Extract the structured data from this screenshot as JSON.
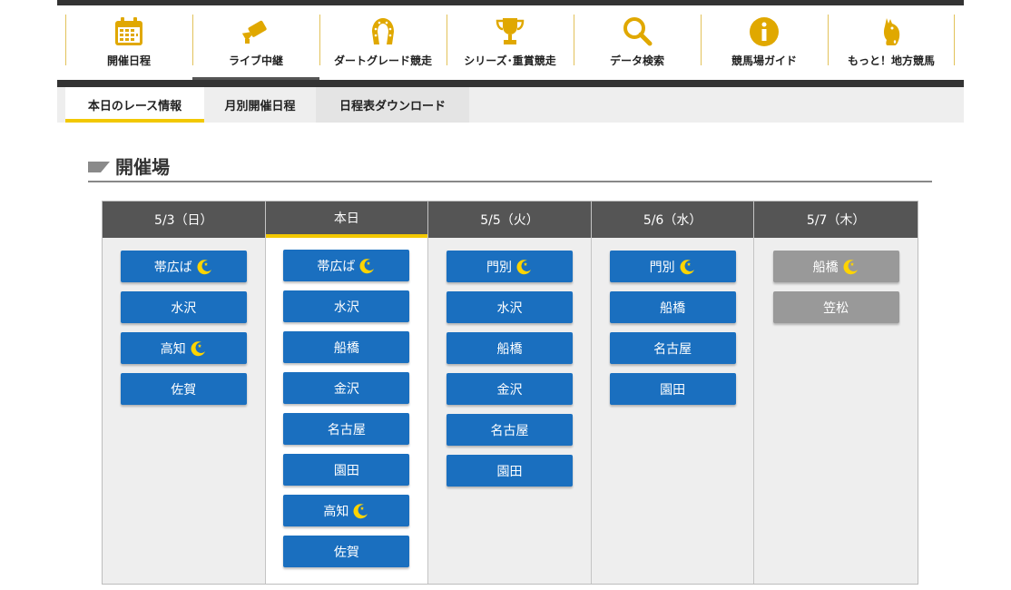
{
  "nav": {
    "items": [
      {
        "label": "開催日程",
        "icon": "calendar-icon"
      },
      {
        "label": "ライブ中継",
        "icon": "camera-icon"
      },
      {
        "label": "ダートグレード競走",
        "icon": "horseshoe-icon"
      },
      {
        "label": "シリーズ･重賞競走",
        "icon": "trophy-icon"
      },
      {
        "label": "データ検索",
        "icon": "search-icon"
      },
      {
        "label": "競馬場ガイド",
        "icon": "info-icon"
      },
      {
        "label": "もっと！地方競馬",
        "icon": "horse-head-icon"
      }
    ],
    "accent": "#e0a800"
  },
  "subtabs": [
    "本日のレース情報",
    "月別開催日程",
    "日程表ダウンロード"
  ],
  "section": {
    "title": "開催場"
  },
  "colors": {
    "venue_blue": "#1a6fbf",
    "venue_gray": "#999999",
    "header_dark": "#555555",
    "highlight_yellow": "#f2c800"
  },
  "days": [
    {
      "label": "5/3（日）",
      "venues": [
        {
          "name": "帯広ば",
          "night": true
        },
        {
          "name": "水沢",
          "night": false
        },
        {
          "name": "高知",
          "night": true
        },
        {
          "name": "佐賀",
          "night": false
        }
      ]
    },
    {
      "label": "本日",
      "venues": [
        {
          "name": "帯広ば",
          "night": true
        },
        {
          "name": "水沢",
          "night": false
        },
        {
          "name": "船橋",
          "night": false
        },
        {
          "name": "金沢",
          "night": false
        },
        {
          "name": "名古屋",
          "night": false
        },
        {
          "name": "園田",
          "night": false
        },
        {
          "name": "高知",
          "night": true
        },
        {
          "name": "佐賀",
          "night": false
        }
      ]
    },
    {
      "label": "5/5（火）",
      "venues": [
        {
          "name": "門別",
          "night": true
        },
        {
          "name": "水沢",
          "night": false
        },
        {
          "name": "船橋",
          "night": false
        },
        {
          "name": "金沢",
          "night": false
        },
        {
          "name": "名古屋",
          "night": false
        },
        {
          "name": "園田",
          "night": false
        }
      ]
    },
    {
      "label": "5/6（水）",
      "venues": [
        {
          "name": "門別",
          "night": true
        },
        {
          "name": "船橋",
          "night": false
        },
        {
          "name": "名古屋",
          "night": false
        },
        {
          "name": "園田",
          "night": false
        }
      ]
    },
    {
      "label": "5/7（木）",
      "venues": [
        {
          "name": "船橋",
          "night": true
        },
        {
          "name": "笠松",
          "night": false
        }
      ]
    }
  ]
}
